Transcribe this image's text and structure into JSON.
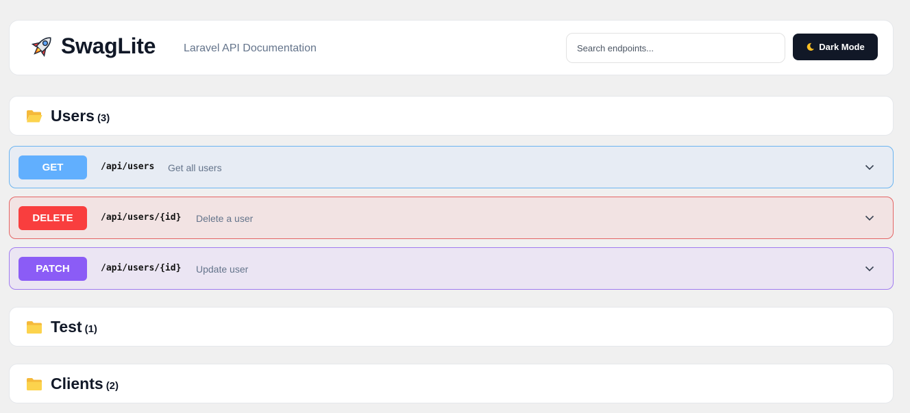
{
  "header": {
    "logo_icon": "rocket-icon",
    "title": "SwagLite",
    "subtitle": "Laravel API Documentation",
    "search_placeholder": "Search endpoints...",
    "dark_mode_icon": "moon-icon",
    "dark_mode_label": "Dark Mode"
  },
  "groups": [
    {
      "icon": "folder-open-icon",
      "name": "Users",
      "count": "(3)",
      "endpoints": [
        {
          "method": "GET",
          "path": "/api/users",
          "description": "Get all users",
          "color": "#61affe"
        },
        {
          "method": "DELETE",
          "path": "/api/users/{id}",
          "description": "Delete a user",
          "color": "#f93e3e"
        },
        {
          "method": "PATCH",
          "path": "/api/users/{id}",
          "description": "Update user",
          "color": "#8b5cf6"
        }
      ]
    },
    {
      "icon": "folder-icon",
      "name": "Test",
      "count": "(1)"
    },
    {
      "icon": "folder-icon",
      "name": "Clients",
      "count": "(2)"
    }
  ],
  "colors": {
    "background": "#f0f0f0",
    "dark_button": "#111827",
    "folder": "#fcd34d"
  }
}
